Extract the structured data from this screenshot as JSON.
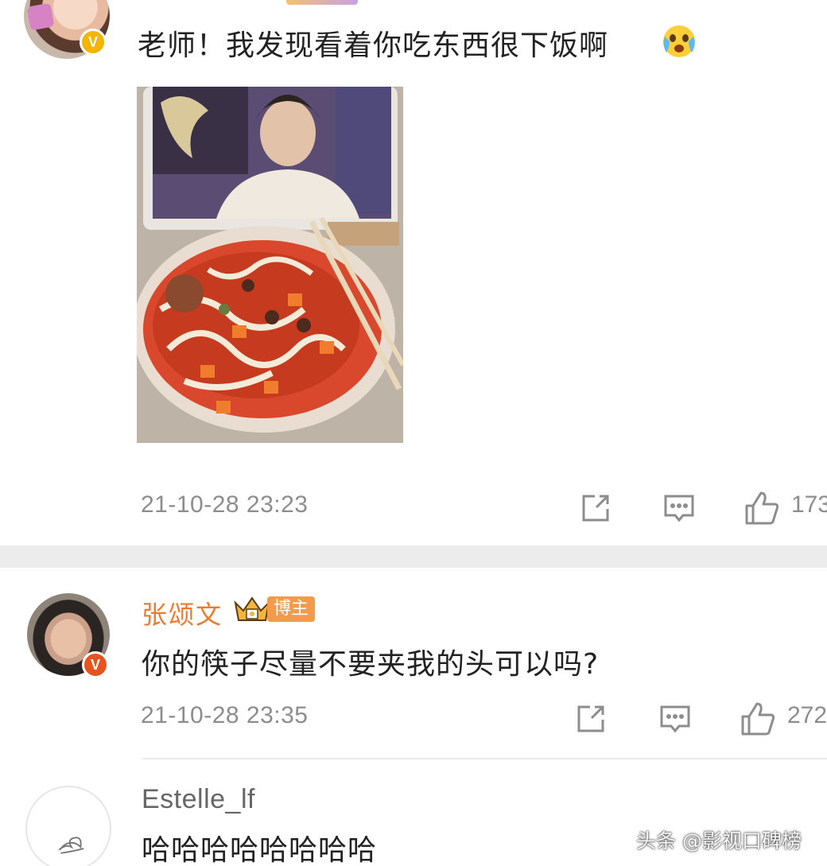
{
  "comments": [
    {
      "username": "",
      "text": "老师！我发现看着你吃东西很下饭啊",
      "emoji": "crying-laughing-face-icon",
      "time": "21-10-28 23:23",
      "likes": "173"
    },
    {
      "username": "张颂文",
      "badge": "博主",
      "text": "你的筷子尽量不要夹我的头可以吗?",
      "time": "21-10-28 23:35",
      "likes": "272"
    },
    {
      "username": "Estelle_lf",
      "text": "哈哈哈哈哈哈哈哈"
    }
  ],
  "watermark": "头条 @影视口碑榜",
  "colors": {
    "username": "#f07a2c",
    "meta": "#8d8d8d",
    "divider": "#ececec",
    "verified_gold": "#f5b400",
    "verified_red": "#e8531d"
  }
}
